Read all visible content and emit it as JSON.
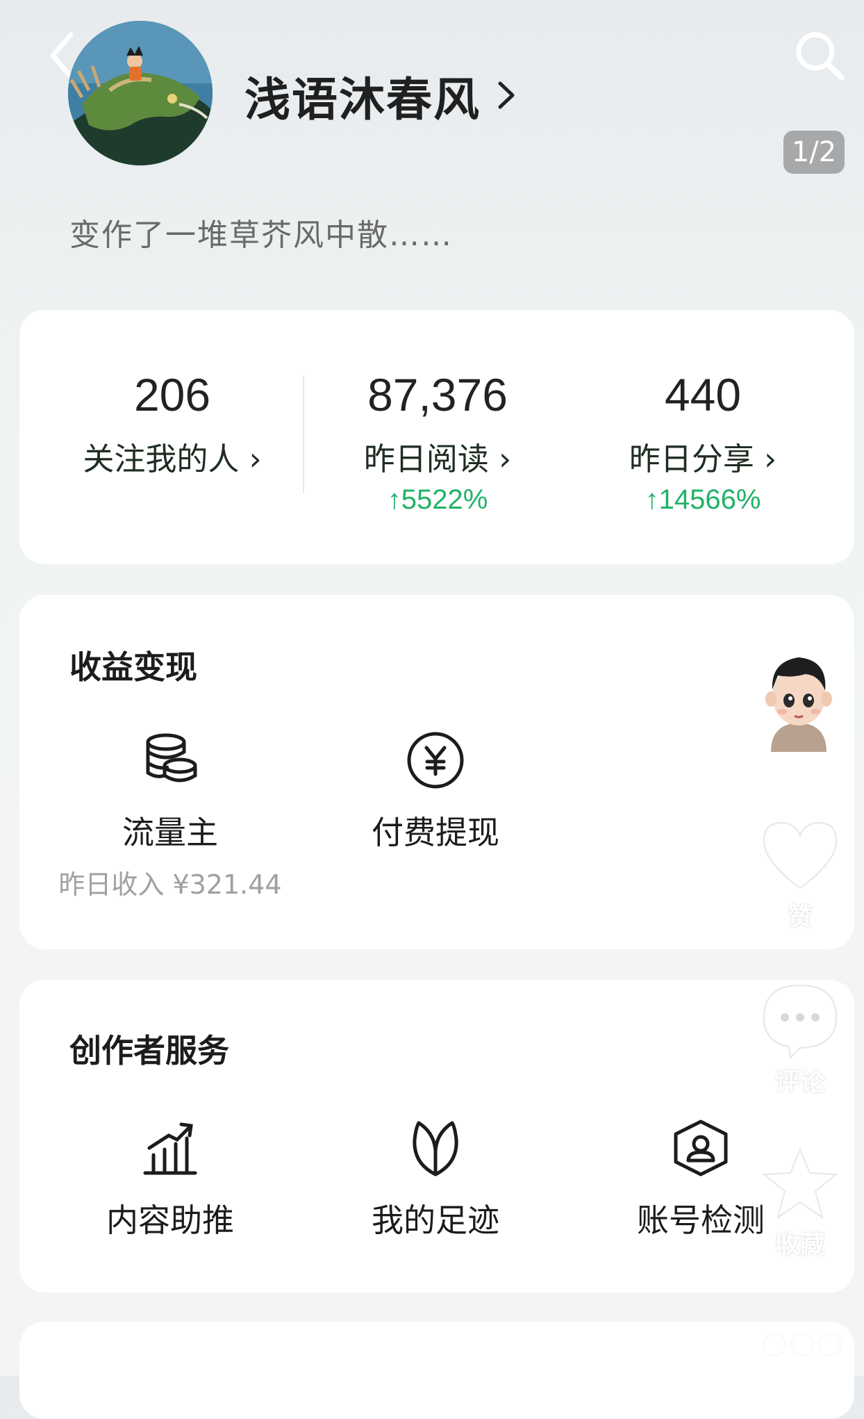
{
  "header": {
    "username": "浅语沐春风",
    "page_indicator": "1/2",
    "bio": "变作了一堆草芥风中散……"
  },
  "stats": [
    {
      "value": "206",
      "label": "关注我的人",
      "trend": ""
    },
    {
      "value": "87,376",
      "label": "昨日阅读",
      "trend": "↑5522%"
    },
    {
      "value": "440",
      "label": "昨日分享",
      "trend": "↑14566%"
    }
  ],
  "income": {
    "title": "收益变现",
    "items": [
      {
        "label": "流量主",
        "sub": "昨日收入 ¥321.44",
        "icon": "coins-icon"
      },
      {
        "label": "付费提现",
        "sub": "",
        "icon": "yen-icon"
      }
    ]
  },
  "creator": {
    "title": "创作者服务",
    "items": [
      {
        "label": "内容助推",
        "icon": "growth-chart-icon"
      },
      {
        "label": "我的足迹",
        "icon": "sprout-icon"
      },
      {
        "label": "账号检测",
        "icon": "account-shield-icon"
      }
    ]
  },
  "side": {
    "like": "赞",
    "comment": "评论",
    "favorite": "收藏"
  },
  "colors": {
    "trend_green": "#20b267",
    "stat_label": "#1f2d22",
    "badge_bg": "#a6a8aa"
  }
}
